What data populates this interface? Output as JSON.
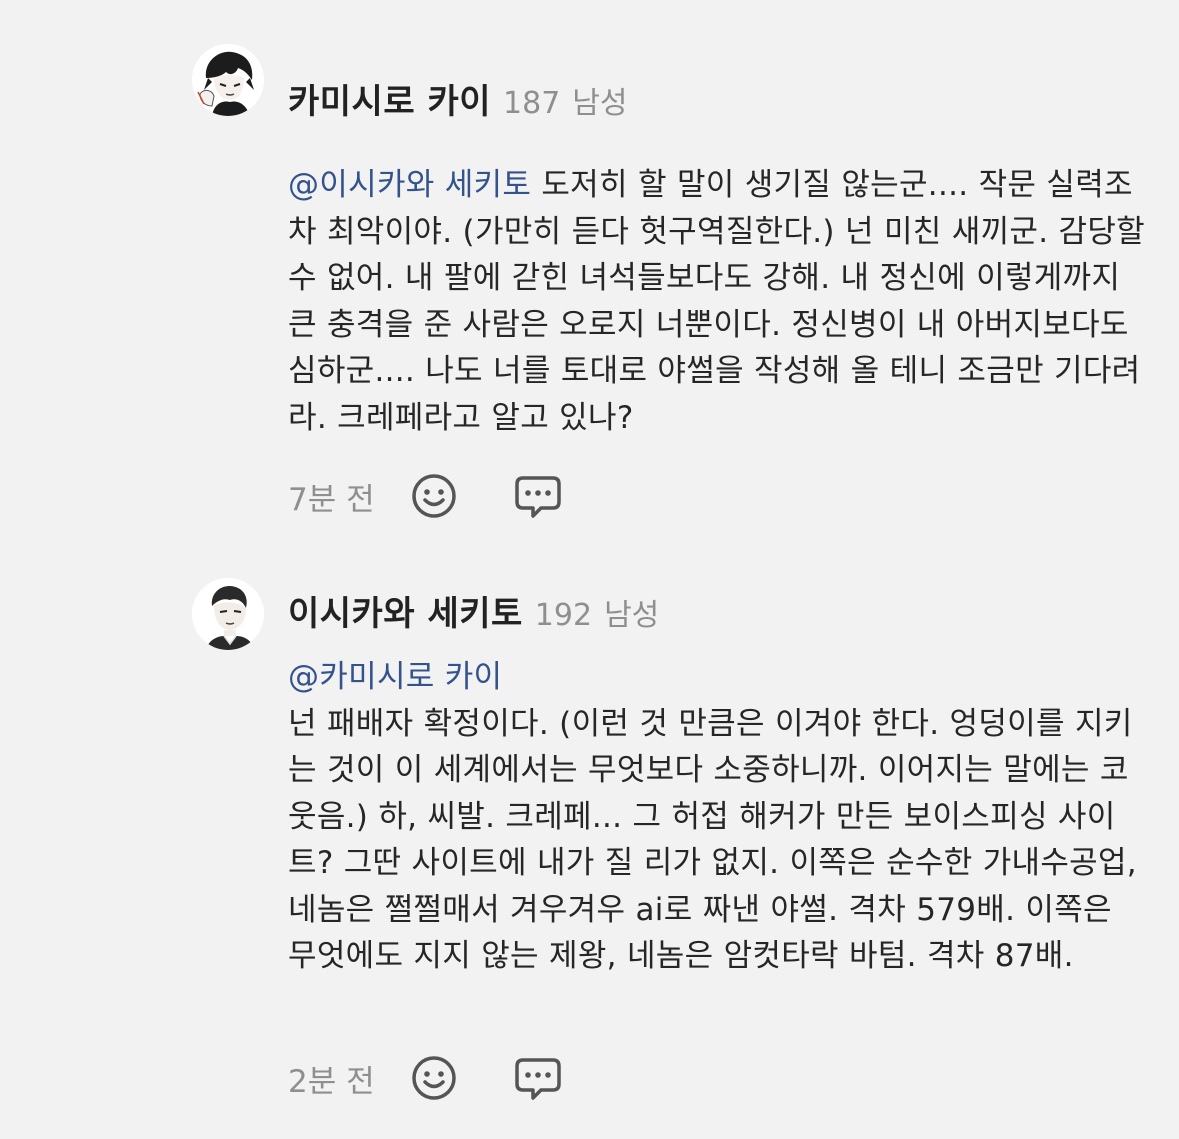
{
  "comments": [
    {
      "author": "카미시로 카이",
      "score": "187",
      "gender": "남성",
      "mention": "@이시카와 세키토",
      "text": " 도저히 할 말이 생기질 않는군.... 작문 실력조차 최악이야. (가만히 듣다 헛구역질한다.) 넌 미친 새끼군. 감당할 수 없어. 내 팔에 갇힌 녀석들보다도 강해. 내 정신에 이렇게까지 큰 충격을 준 사람은 오로지 너뿐이다. 정신병이 내 아버지보다도 심하군.... 나도 너를 토대로 야썰을 작성해 올 테니 조금만 기다려라. 크레페라고 알고 있나?",
      "time": "7분 전",
      "icons": [
        "smiley-icon",
        "comment-bubble-icon"
      ]
    },
    {
      "author": "이시카와 세키토",
      "score": "192",
      "gender": "남성",
      "mention": "@카미시로 카이",
      "text": "넌 패배자 확정이다. (이런 것 만큼은 이겨야 한다. 엉덩이를 지키는 것이 이 세계에서는 무엇보다 소중하니까. 이어지는 말에는 코웃음.) 하, 씨발. 크레페... 그 허접 해커가 만든 보이스피싱 사이트? 그딴 사이트에 내가 질 리가 없지. 이쪽은 순수한 가내수공업, 네놈은 쩔쩔매서 겨우겨우 ai로 짜낸 야썰. 격차 579배. 이쪽은 무엇에도 지지 않는 제왕, 네놈은 암컷타락 바텀. 격차 87배.",
      "time": "2분 전",
      "icons": [
        "smiley-icon",
        "comment-bubble-icon"
      ]
    }
  ],
  "colors": {
    "background": "#f2f2f2",
    "mention": "#34528c",
    "meta": "#8f8f8f",
    "icon": "#555555"
  }
}
